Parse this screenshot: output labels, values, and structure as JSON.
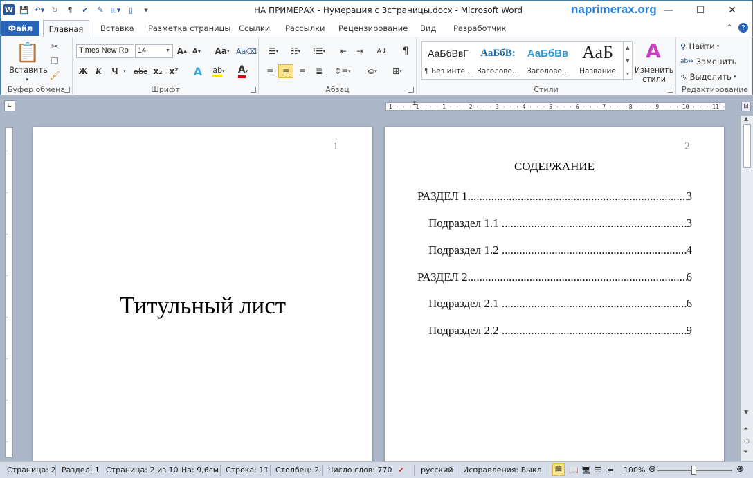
{
  "window": {
    "title": "НА ПРИМЕРАХ - Нумерация с 3страницы.docx - Microsoft Word",
    "brand": "naprimerax.org"
  },
  "tabs": {
    "file": "Файл",
    "items": [
      "Главная",
      "Вставка",
      "Разметка страницы",
      "Ссылки",
      "Рассылки",
      "Рецензирование",
      "Вид",
      "Разработчик"
    ]
  },
  "ribbon": {
    "clipboard": {
      "paste": "Вставить",
      "label": "Буфер обмена"
    },
    "font": {
      "name": "Times New Ro",
      "size": "14",
      "case": "Аа",
      "bold": "Ж",
      "italic": "К",
      "underline": "Ч",
      "strike": "abc",
      "sub": "x₂",
      "sup": "x²",
      "label": "Шрифт"
    },
    "paragraph": {
      "label": "Абзац"
    },
    "styles": {
      "label": "Стили",
      "items": [
        {
          "sample": "АаБбВвГ",
          "name": "¶ Без инте..."
        },
        {
          "sample": "АаБбВ:",
          "name": "Заголово..."
        },
        {
          "sample": "АаБбВв",
          "name": "Заголово..."
        },
        {
          "sample": "АаБ",
          "name": "Название"
        }
      ],
      "change": "Изменить стили"
    },
    "editing": {
      "find": "Найти",
      "replace": "Заменить",
      "select": "Выделить",
      "label": "Редактирование"
    }
  },
  "ruler": {
    "marks": "1 · · · 1 · · · 1 · · · 2 · · · 3 · · · 4 · · · 5 · · · 6 · · · 7 · · · 8 · · · 9 · · · 10 · · · 11 ·"
  },
  "pages": [
    {
      "number": "1",
      "title": "Титульный лист"
    },
    {
      "number": "2",
      "heading": "СОДЕРЖАНИЕ",
      "toc": [
        {
          "label": "РАЗДЕЛ 1",
          "page": "3"
        },
        {
          "label": "Подраздел 1.1",
          "page": "3"
        },
        {
          "label": "Подраздел 1.2",
          "page": "4"
        },
        {
          "label": "РАЗДЕЛ 2",
          "page": "6"
        },
        {
          "label": "Подраздел 2.1",
          "page": "6"
        },
        {
          "label": "Подраздел 2.2",
          "page": "9"
        }
      ]
    }
  ],
  "status": {
    "page": "Страница: 2",
    "section": "Раздел: 1",
    "pages": "Страница: 2 из 10",
    "at": "На: 9,6см",
    "line": "Строка: 11",
    "column": "Столбец: 2",
    "words": "Число слов: 770",
    "language": "русский",
    "track": "Исправления: Выкл.",
    "zoom": "100%"
  }
}
